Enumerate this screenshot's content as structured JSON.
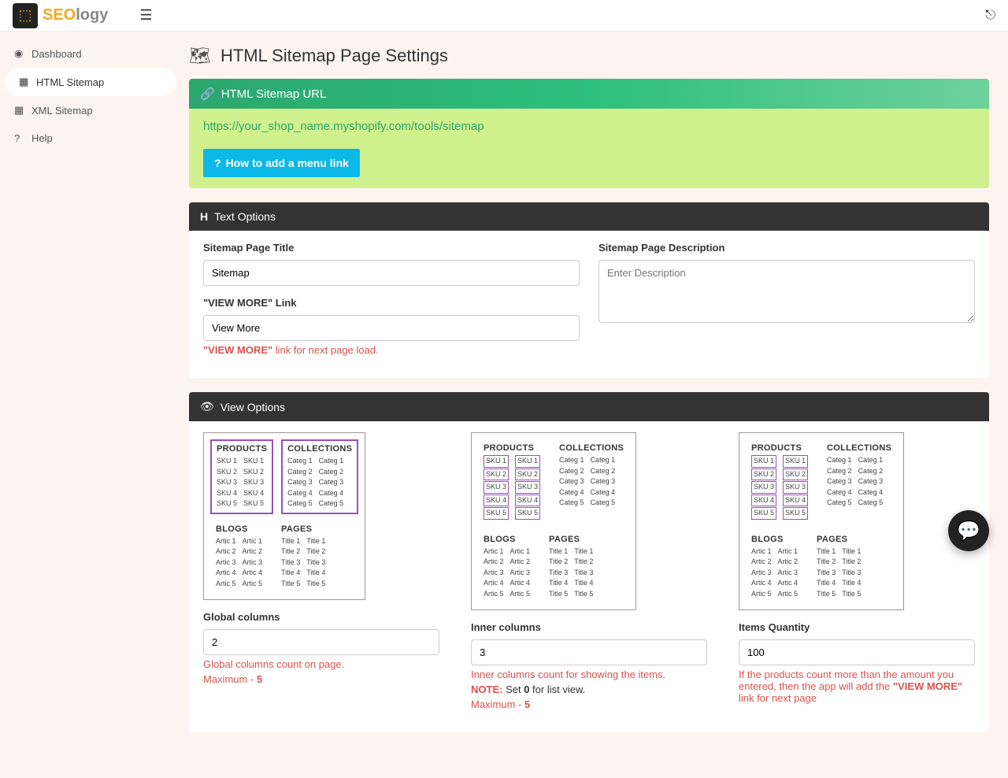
{
  "brand": {
    "seo": "SEO",
    "logy": "logy"
  },
  "sidebar": {
    "items": [
      {
        "label": "Dashboard",
        "icon": "⚙"
      },
      {
        "label": "HTML Sitemap",
        "icon": "🗺"
      },
      {
        "label": "XML Sitemap",
        "icon": "🗺"
      },
      {
        "label": "Help",
        "icon": "?"
      }
    ]
  },
  "page": {
    "title": "HTML Sitemap Page Settings"
  },
  "url_panel": {
    "title": "HTML Sitemap URL",
    "url": "https://your_shop_name.myshopify.com/tools/sitemap",
    "button": "How to add a menu link"
  },
  "text_options": {
    "title": "Text Options",
    "page_title_label": "Sitemap Page Title",
    "page_title_value": "Sitemap",
    "view_more_label": "\"VIEW MORE\" Link",
    "view_more_value": "View More",
    "view_more_help_bold": "\"VIEW MORE\"",
    "view_more_help_rest": " link for next page load.",
    "desc_label": "Sitemap Page Description",
    "desc_placeholder": "Enter Description"
  },
  "view_options": {
    "title": "View Options",
    "diagram_headers": {
      "products": "PRODUCTS",
      "collections": "COLLECTIONS",
      "blogs": "BLOGS",
      "pages": "PAGES"
    },
    "global": {
      "label": "Global columns",
      "value": "2",
      "help1": "Global columns count on page.",
      "help2_pre": "Maximum - ",
      "help2_val": "5"
    },
    "inner": {
      "label": "Inner columns",
      "value": "3",
      "help1": "Inner columns count for showing the items.",
      "help2_note": "NOTE:",
      "help2_mid": " Set ",
      "help2_zero": "0",
      "help2_rest": " for list view.",
      "help3_pre": "Maximum - ",
      "help3_val": "5"
    },
    "items": {
      "label": "Items Quantity",
      "value": "100",
      "help1": "If the products count more than the amount you entered, then the app will add the ",
      "help1_bold": "\"VIEW MORE\"",
      "help1_rest": " link for next page"
    }
  }
}
